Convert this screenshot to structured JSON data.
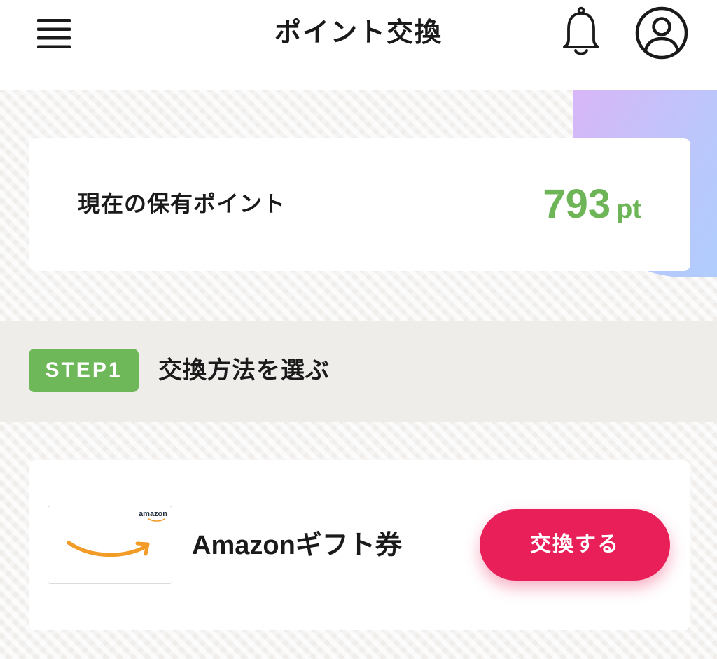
{
  "header": {
    "title": "ポイント交換",
    "menu_icon": "hamburger-icon",
    "notification_icon": "bell-icon",
    "account_icon": "user-icon"
  },
  "points": {
    "label": "現在の保有ポイント",
    "value": "793",
    "unit": "pt"
  },
  "step": {
    "badge": "STEP1",
    "title": "交換方法を選ぶ"
  },
  "exchange_options": [
    {
      "thumb_brand": "amazon",
      "name": "Amazonギフト券",
      "button_label": "交換する"
    }
  ],
  "colors": {
    "accent_green": "#6fb85a",
    "points_green": "#6db557",
    "exchange_button": "#e81f58",
    "amazon_orange": "#f29b27",
    "gradient": [
      "#d8b6f7",
      "#bcc6fb",
      "#a6d2ff"
    ]
  }
}
